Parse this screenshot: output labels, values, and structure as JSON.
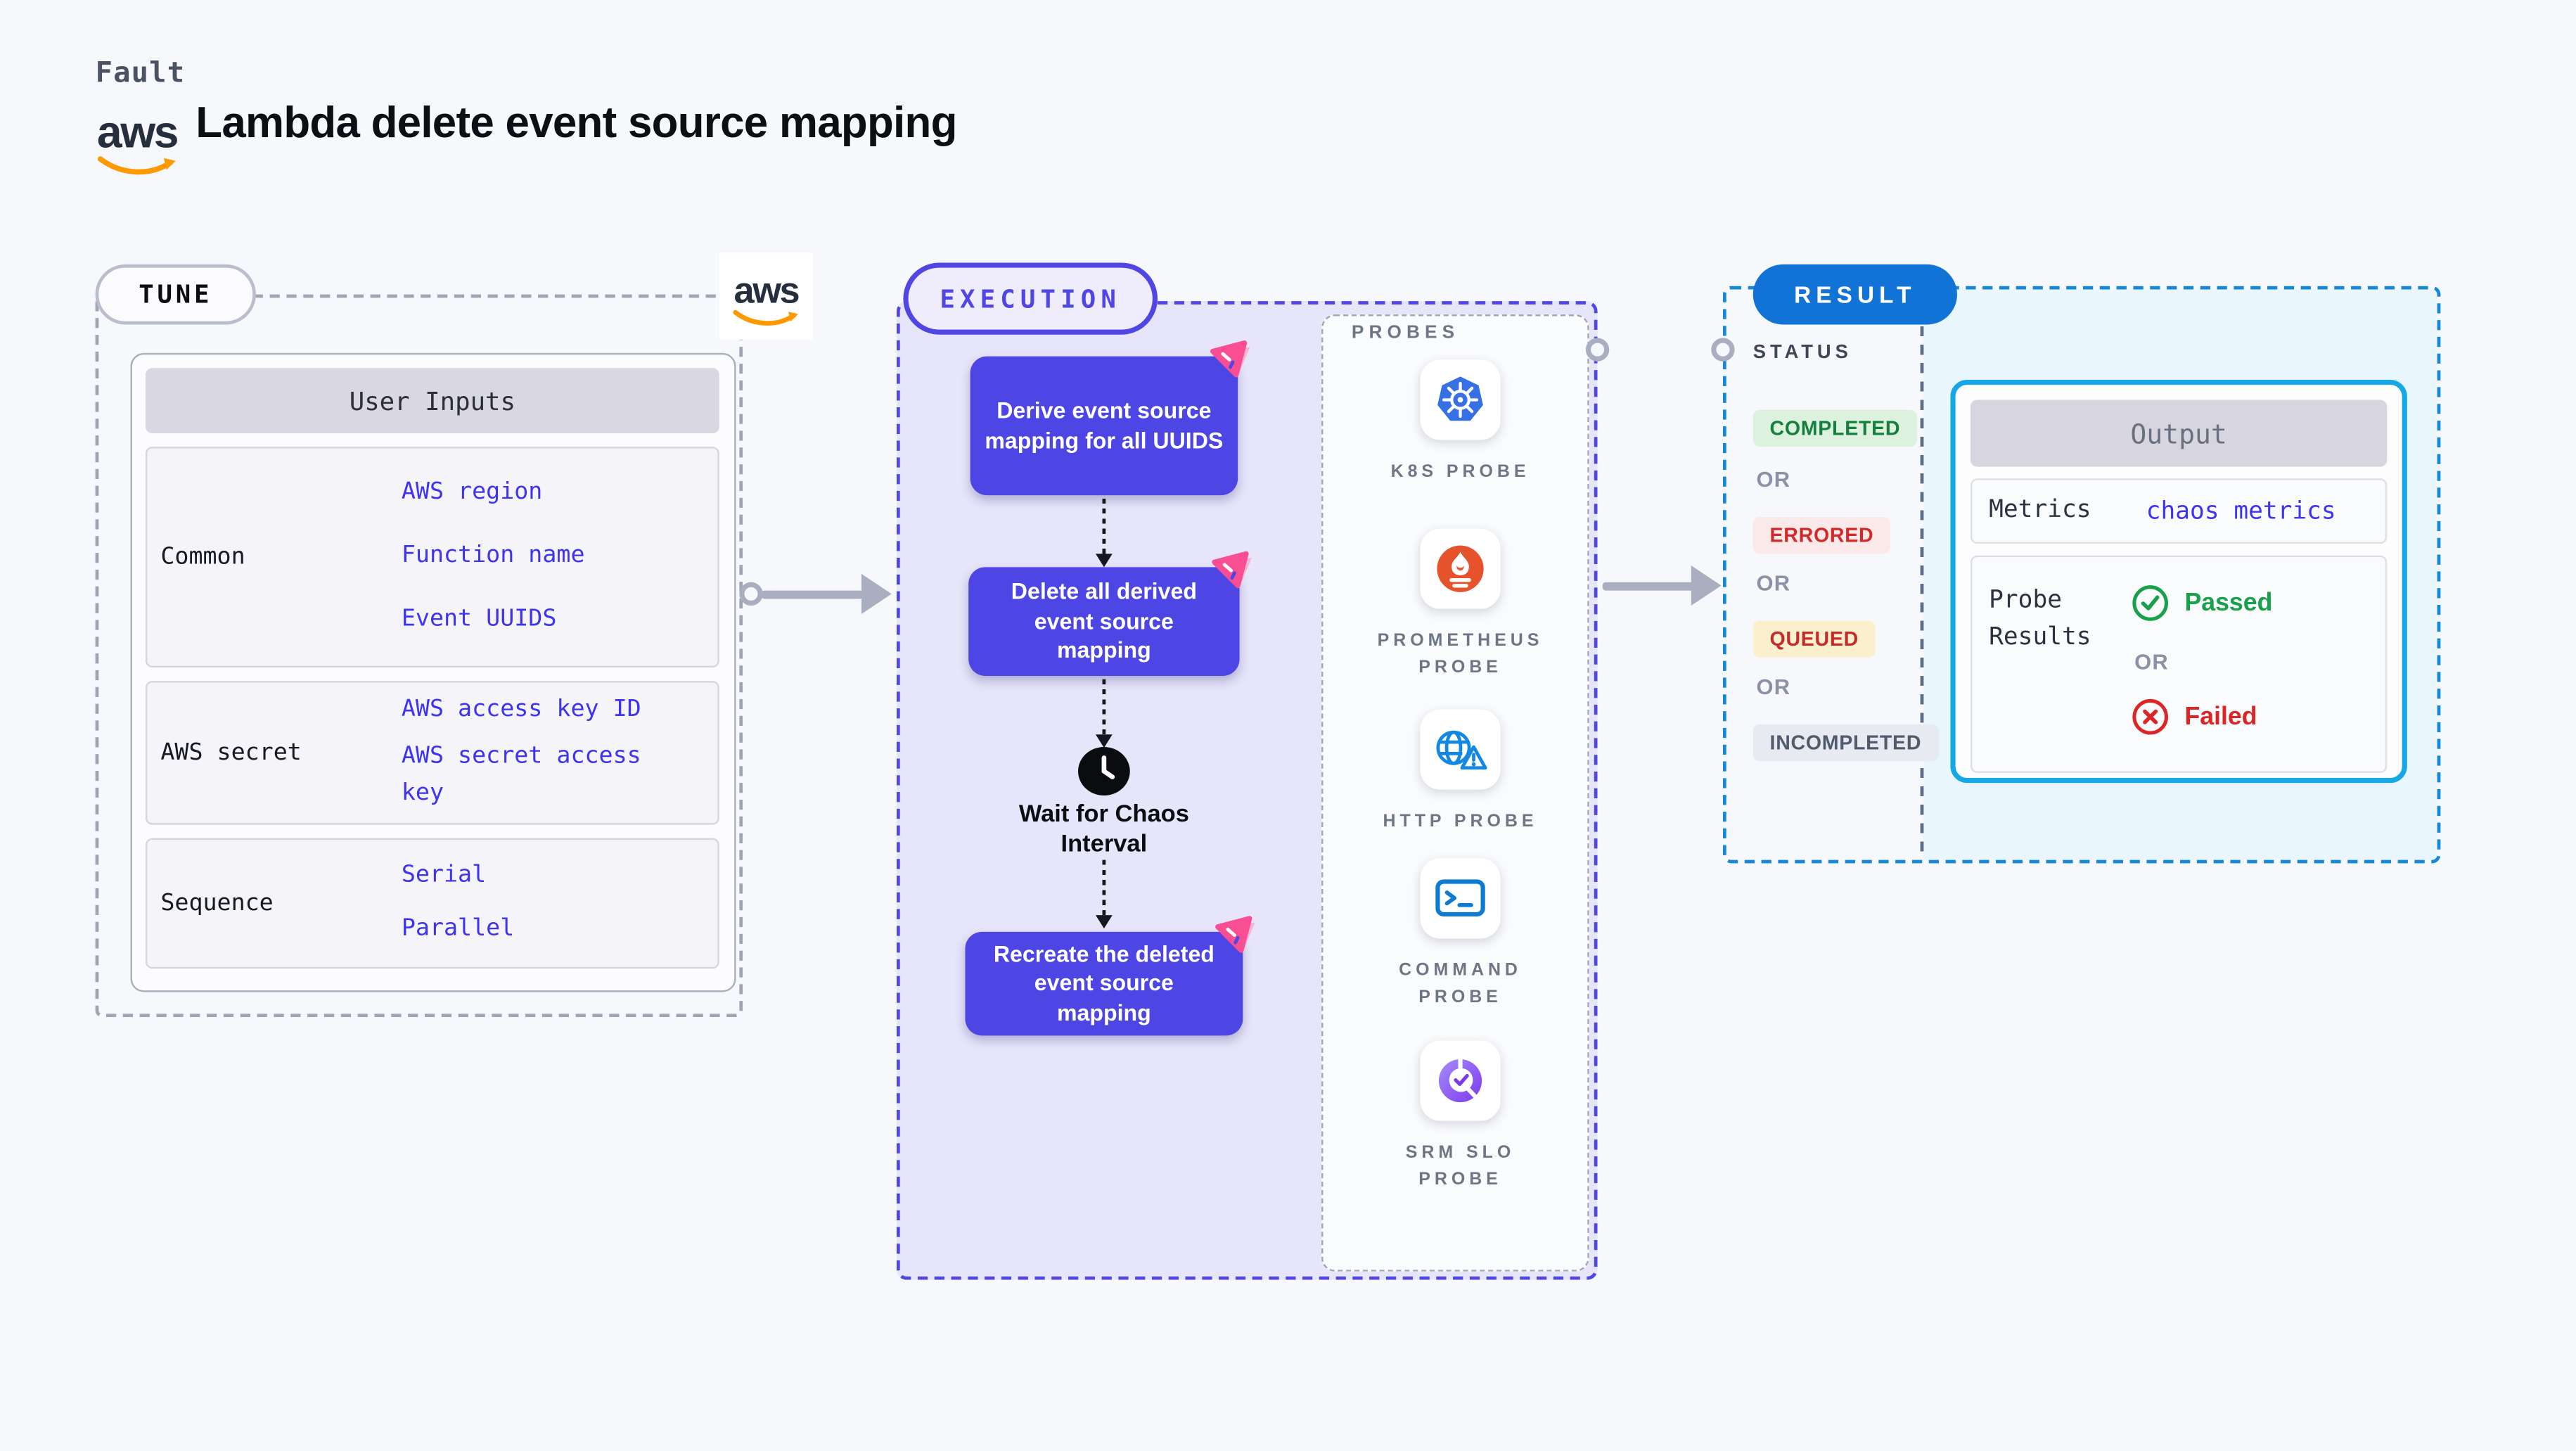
{
  "header": {
    "kicker": "Fault",
    "title": "Lambda delete event source mapping",
    "aws_logo": "aws"
  },
  "tune": {
    "pill": "TUNE",
    "aws_logo": "aws",
    "table": {
      "header": "User Inputs",
      "rows": [
        {
          "label": "Common",
          "links": [
            "AWS region",
            "Function name",
            "Event UUIDS"
          ]
        },
        {
          "label": "AWS secret",
          "links": [
            "AWS access key ID",
            "AWS secret access key"
          ]
        },
        {
          "label": "Sequence",
          "links": [
            "Serial",
            "Parallel"
          ]
        }
      ]
    }
  },
  "execution": {
    "pill": "EXECUTION",
    "steps": [
      "Derive event source\nmapping for all UUIDS",
      "Delete all derived\nevent source\nmapping",
      "Recreate the deleted\nevent source\nmapping"
    ],
    "wait_label": "Wait for Chaos\nInterval",
    "probes": {
      "title": "PROBES",
      "items": [
        {
          "label": "K8S PROBE",
          "icon": "kubernetes-icon"
        },
        {
          "label": "PROMETHEUS\nPROBE",
          "icon": "prometheus-icon"
        },
        {
          "label": "HTTP PROBE",
          "icon": "http-globe-icon"
        },
        {
          "label": "COMMAND\nPROBE",
          "icon": "terminal-icon"
        },
        {
          "label": "SRM SLO\nPROBE",
          "icon": "slo-donut-icon"
        }
      ]
    }
  },
  "result": {
    "pill": "RESULT",
    "status_title": "STATUS",
    "or_label": "OR",
    "statuses": [
      {
        "label": "COMPLETED",
        "kind": "completed"
      },
      {
        "label": "ERRORED",
        "kind": "errored"
      },
      {
        "label": "QUEUED",
        "kind": "queued"
      },
      {
        "label": "INCOMPLETED",
        "kind": "incompleted"
      }
    ],
    "output": {
      "header": "Output",
      "metrics_label": "Metrics",
      "metrics_value": "chaos metrics",
      "probe_results_label": "Probe\nResults",
      "passed": "Passed",
      "or_label": "OR",
      "failed": "Failed"
    }
  },
  "colors": {
    "page_bg": "#F7F8FB",
    "indigo": "#4F46E5",
    "step_fill": "#4D45E4",
    "lavender_fill": "#E7E5FA",
    "link_blue": "#3D33F0",
    "result_blue": "#1273D6",
    "result_border": "#1588D8",
    "output_cyan": "#14A9E6",
    "cyan_fill": "#E9F6FD",
    "pink_badge": "#FA4E94",
    "passed_green": "#18A04B",
    "failed_red": "#DC2626",
    "aws_orange": "#FF9900",
    "gray_arrow": "#A9AEC0"
  }
}
